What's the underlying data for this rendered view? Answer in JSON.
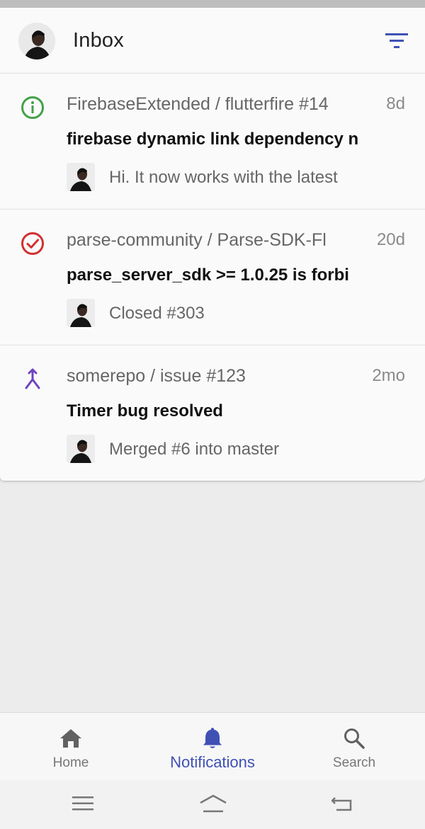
{
  "header": {
    "title": "Inbox",
    "avatar_icon": "user-avatar",
    "filter_icon": "filter-icon"
  },
  "notifications": [
    {
      "type": "issue-open",
      "icon": "info-circle-icon",
      "icon_color": "#43a047",
      "repo": "FirebaseExtended / flutterfire #14",
      "time": "8d",
      "subject": "firebase dynamic link dependency n",
      "snippet": "Hi. It now works with the latest"
    },
    {
      "type": "issue-closed",
      "icon": "check-circle-icon",
      "icon_color": "#d32f2f",
      "repo": "parse-community / Parse-SDK-Fl",
      "time": "20d",
      "subject": "parse_server_sdk >= 1.0.25 is forbi",
      "snippet": "Closed #303"
    },
    {
      "type": "pr-merged",
      "icon": "merge-icon",
      "icon_color": "#6f42c1",
      "repo": "somerepo / issue #123",
      "time": "2mo",
      "subject": "Timer bug resolved",
      "snippet": "Merged #6 into master"
    }
  ],
  "bottom_nav": {
    "items": [
      {
        "label": "Home",
        "icon": "home-icon",
        "active": false
      },
      {
        "label": "Notifications",
        "icon": "bell-icon",
        "active": true
      },
      {
        "label": "Search",
        "icon": "search-icon",
        "active": false
      }
    ],
    "active_color": "#3f51b5",
    "inactive_color": "#616161"
  },
  "system_nav": {
    "buttons": [
      "menu-icon",
      "home-outline-icon",
      "back-icon"
    ]
  }
}
